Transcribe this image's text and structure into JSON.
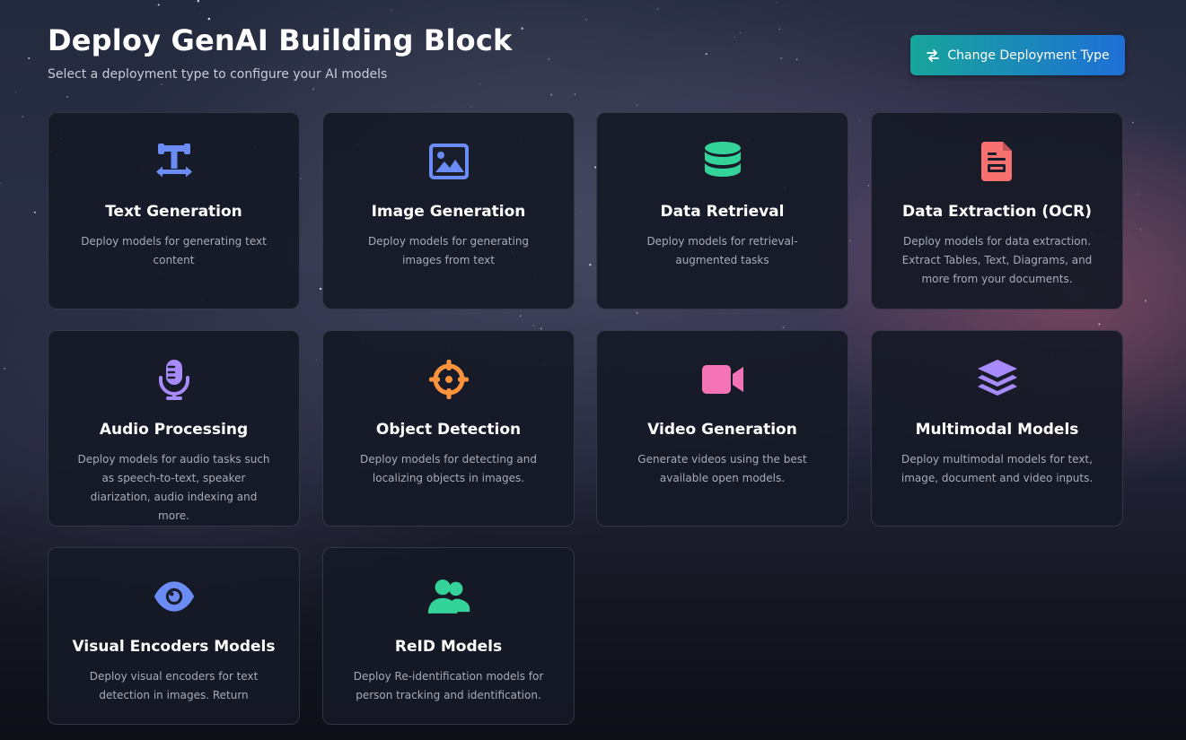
{
  "header": {
    "title": "Deploy GenAI Building Block",
    "subtitle": "Select a deployment type to configure your AI models",
    "change_button_label": "Change Deployment Type"
  },
  "cards": [
    {
      "title": "Text Generation",
      "description": "Deploy models for generating text content",
      "icon": "text-icon",
      "color": "#6b8cf5"
    },
    {
      "title": "Image Generation",
      "description": "Deploy models for generating images from text",
      "icon": "image-icon",
      "color": "#6b8cf5"
    },
    {
      "title": "Data Retrieval",
      "description": "Deploy models for retrieval-augmented tasks",
      "icon": "database-icon",
      "color": "#34d399"
    },
    {
      "title": "Data Extraction (OCR)",
      "description": "Deploy models for data extraction. Extract Tables, Text, Diagrams, and more from your documents.",
      "icon": "document-icon",
      "color": "#f87171"
    },
    {
      "title": "Audio Processing",
      "description": "Deploy models for audio tasks such as speech-to-text, speaker diarization, audio indexing and more.",
      "icon": "microphone-icon",
      "color": "#a78bfa"
    },
    {
      "title": "Object Detection",
      "description": "Deploy models for detecting and localizing objects in images.",
      "icon": "crosshairs-icon",
      "color": "#fb923c"
    },
    {
      "title": "Video Generation",
      "description": "Generate videos using the best available open models.",
      "icon": "video-icon",
      "color": "#f472b6"
    },
    {
      "title": "Multimodal Models",
      "description": "Deploy multimodal models for text, image, document and video inputs.",
      "icon": "layers-icon",
      "color": "#a78bfa"
    },
    {
      "title": "Visual Encoders Models",
      "description": "Deploy visual encoders for text detection in images. Return",
      "icon": "eye-icon",
      "color": "#6b8cf5"
    },
    {
      "title": "ReID Models",
      "description": "Deploy Re-identification models for person tracking and identification.",
      "icon": "users-icon",
      "color": "#34d399"
    }
  ]
}
